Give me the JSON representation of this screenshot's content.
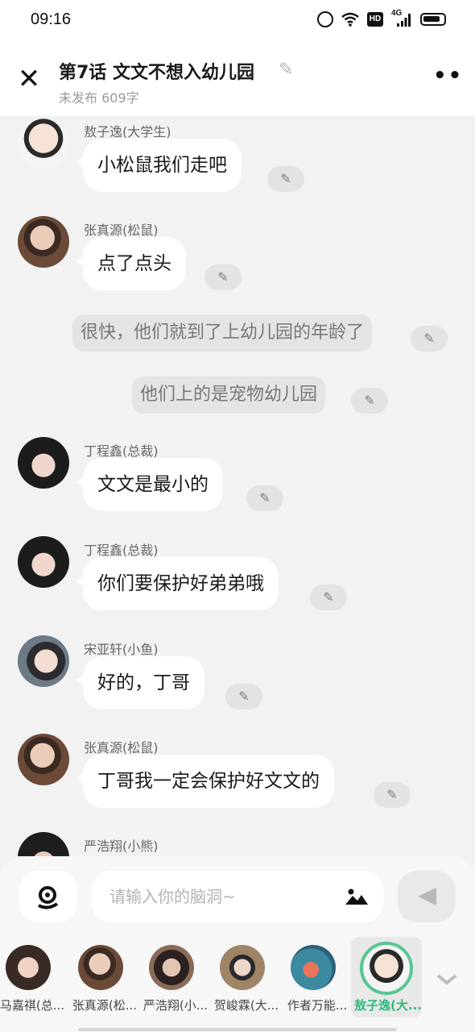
{
  "status": {
    "time": "09:16",
    "hd": "HD",
    "net": "4G"
  },
  "header": {
    "title": "第7话   文文不想入幼儿园",
    "subtitle": "未发布 609字"
  },
  "messages": [
    {
      "type": "char",
      "sender": "敖子逸(大学生)",
      "text": "小松鼠我们走吧",
      "avatar": "aoziyi"
    },
    {
      "type": "char",
      "sender": "张真源(松鼠)",
      "text": "点了点头",
      "avatar": "zhangzhenyuan"
    },
    {
      "type": "narration",
      "text": "很快，他们就到了上幼儿园的年龄了"
    },
    {
      "type": "narration",
      "text": "他们上的是宠物幼儿园"
    },
    {
      "type": "char",
      "sender": "丁程鑫(总裁)",
      "text": "文文是最小的",
      "avatar": "dingchengxin"
    },
    {
      "type": "char",
      "sender": "丁程鑫(总裁)",
      "text": "你们要保护好弟弟哦",
      "avatar": "dingchengxin"
    },
    {
      "type": "char",
      "sender": "宋亚轩(小鱼)",
      "text": "好的，丁哥",
      "avatar": "songyaxuan"
    },
    {
      "type": "char",
      "sender": "张真源(松鼠)",
      "text": "丁哥我一定会保护好文文的",
      "avatar": "zhangzhenyuan"
    },
    {
      "type": "char",
      "sender": "严浩翔(小熊)",
      "text": "",
      "avatar": "yanhaoxiang"
    }
  ],
  "input": {
    "placeholder": "请输入你的脑洞~"
  },
  "characters": [
    {
      "name": "马嘉祺(总...",
      "selected": false
    },
    {
      "name": "张真源(松...",
      "selected": false
    },
    {
      "name": "严浩翔(小...",
      "selected": false
    },
    {
      "name": "贺峻霖(大...",
      "selected": false
    },
    {
      "name": "作者万能...",
      "selected": false
    },
    {
      "name": "敖子逸(大...",
      "selected": true
    }
  ],
  "colors": {
    "accent": "#2db87a",
    "bubble": "#ffffff",
    "background": "#f2f2f2",
    "narration_bg": "#e4e4e4"
  },
  "icons": {
    "close": "close-icon",
    "more": "more-icon",
    "edit": "pencil-icon",
    "voice": "voice-icon",
    "image": "image-icon",
    "send": "send-icon",
    "expand": "chevron-down-icon"
  }
}
